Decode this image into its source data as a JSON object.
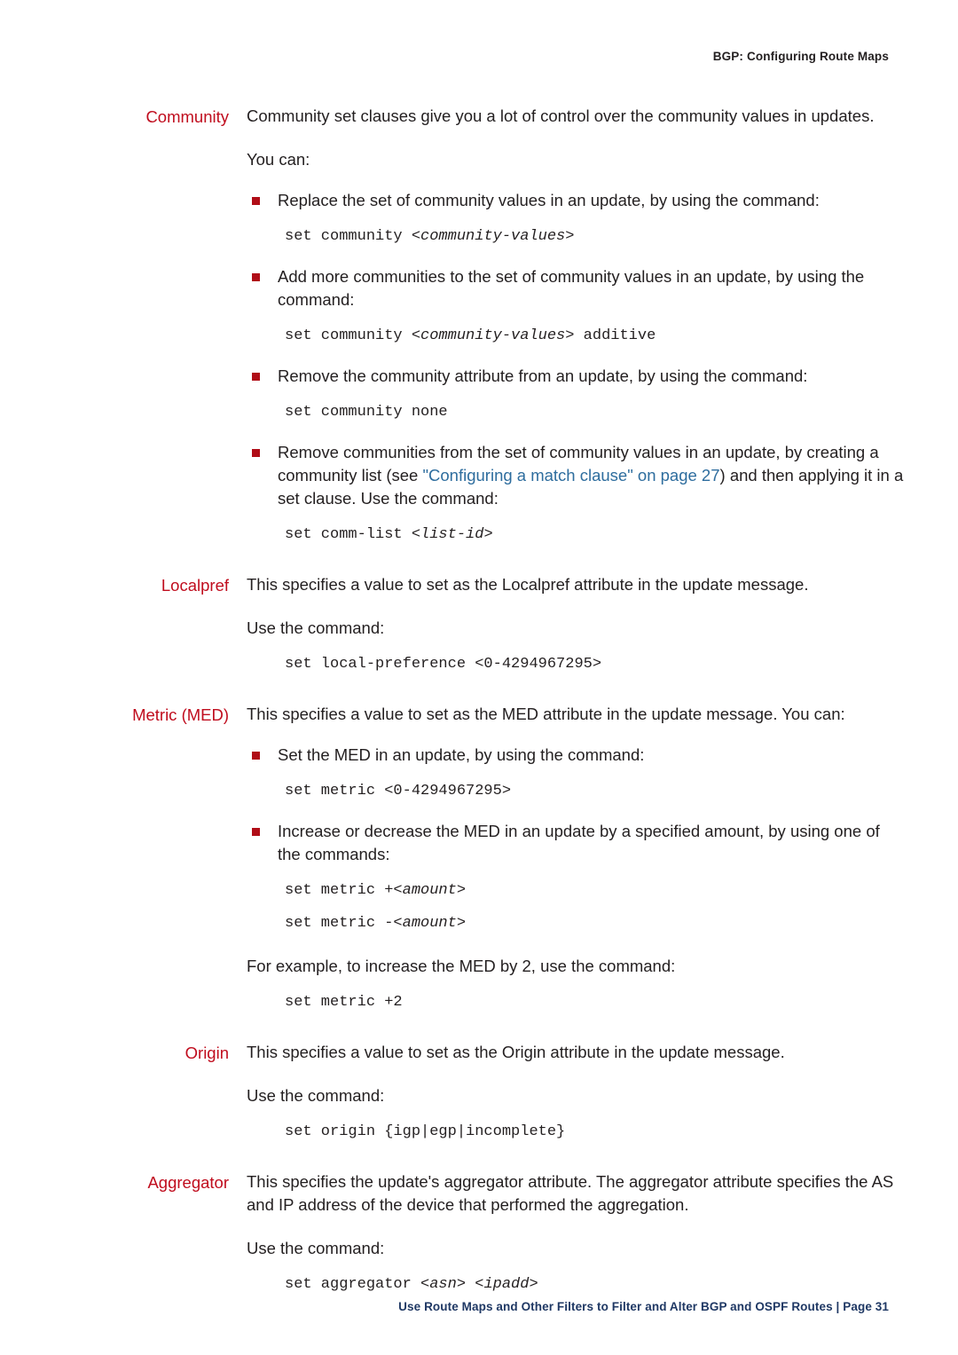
{
  "header": {
    "running_title": "BGP: Configuring Route Maps"
  },
  "footer": {
    "text": "Use Route Maps and Other Filters to Filter and Alter BGP and OSPF Routes | Page 31"
  },
  "colors": {
    "label_red": "#c00d1e",
    "bullet_red": "#b00d17",
    "link_blue": "#2e6d9e",
    "footer_navy": "#1f3864",
    "body_text": "#231f20",
    "page_background": "#ffffff"
  },
  "sections": [
    {
      "label": "Community",
      "intro": "Community set clauses give you a lot of control over the community values in updates.",
      "lead_in": "You can:",
      "bullets": [
        {
          "text": "Replace the set of community values in an update, by using the command:",
          "code_prefix": "set community ",
          "code_italic": "<community-values>",
          "code_suffix": ""
        },
        {
          "text": "Add more communities to the set of community values in an update, by using the command:",
          "code_prefix": "set community ",
          "code_italic": "<community-values>",
          "code_suffix": " additive"
        },
        {
          "text": "Remove the community attribute from an update, by using the command:",
          "code_prefix": "set community none",
          "code_italic": "",
          "code_suffix": ""
        }
      ],
      "link_bullet": {
        "text_before": "Remove communities from the set of community values in an update, by creating a community list (see ",
        "link_text": "\"Configuring a match clause\" on page 27",
        "text_after": ") and then applying it in a set clause. Use the command:",
        "code_prefix": "set comm-list ",
        "code_italic": "<list-id>",
        "code_suffix": ""
      }
    },
    {
      "label": "Localpref",
      "intro": "This specifies a value to set as the Localpref attribute in the update message.",
      "use_line": "Use the command:",
      "code": "set local-preference <0-4294967295>"
    },
    {
      "label": "Metric (MED)",
      "intro": "This specifies a value to set as the MED attribute in the update message. You can:",
      "bullets": [
        {
          "text": "Set the MED in an update, by using the command:",
          "code": "set metric <0-4294967295>"
        },
        {
          "text": "Increase or decrease the MED in an update by a specified amount, by using one of the commands:",
          "code_lines": [
            {
              "prefix": "set metric +",
              "italic": "<amount>"
            },
            {
              "prefix": "set metric -",
              "italic": "<amount>"
            }
          ]
        }
      ],
      "example_line": "For example, to increase the MED by 2, use the command:",
      "example_code": "set metric +2"
    },
    {
      "label": "Origin",
      "intro": "This specifies a value to set as the Origin attribute in the update message.",
      "use_line": "Use the command:",
      "code": "set origin {igp|egp|incomplete}"
    },
    {
      "label": "Aggregator",
      "intro": "This specifies the update's aggregator attribute. The aggregator attribute specifies the AS and IP address of the device that performed the aggregation.",
      "use_line": "Use the command:",
      "code_prefix": "set aggregator ",
      "code_italic_1": "<asn>",
      "code_mid": " ",
      "code_italic_2": "<ipadd>"
    }
  ]
}
